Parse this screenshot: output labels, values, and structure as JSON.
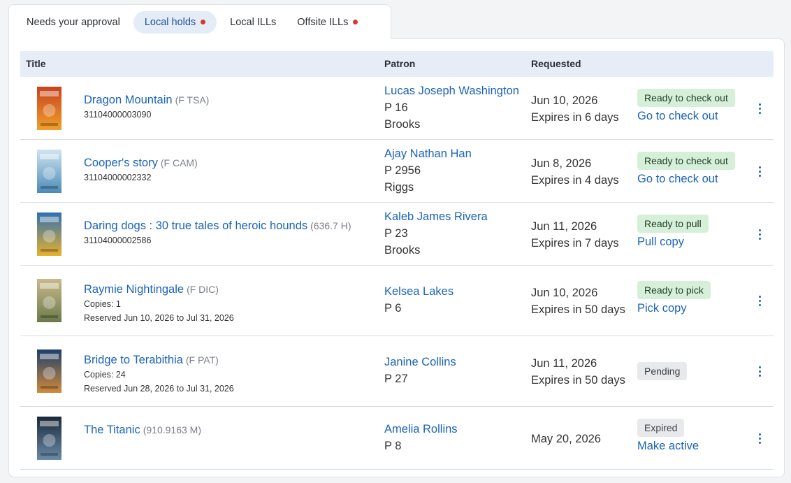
{
  "tabs": [
    {
      "label": "Needs your approval",
      "active": false,
      "dot": false
    },
    {
      "label": "Local holds",
      "active": true,
      "dot": true
    },
    {
      "label": "Local ILLs",
      "active": false,
      "dot": false
    },
    {
      "label": "Offsite ILLs",
      "active": false,
      "dot": true
    }
  ],
  "table": {
    "headers": {
      "title": "Title",
      "patron": "Patron",
      "requested": "Requested"
    },
    "rows": [
      {
        "title": "Dragon Mountain",
        "call": "(F TSA)",
        "sub1": "31104000003090",
        "sub2": "",
        "patron_name": "Lucas Joseph Washington",
        "patron_id": "P 16",
        "patron_loc": "Brooks",
        "date": "Jun 10, 2026",
        "expires": "Expires in 6 days",
        "status": "Ready to check out",
        "status_color": "green",
        "action": "Go to check out",
        "cover_colors": [
          "#c8421f",
          "#f0a02a"
        ]
      },
      {
        "title": "Cooper's story",
        "call": "(F CAM)",
        "sub1": "31104000002332",
        "sub2": "",
        "patron_name": "Ajay Nathan Han",
        "patron_id": "P 2956",
        "patron_loc": "Riggs",
        "date": "Jun 8, 2026",
        "expires": "Expires in 4 days",
        "status": "Ready to check out",
        "status_color": "green",
        "action": "Go to check out",
        "cover_colors": [
          "#cfe3f0",
          "#4a8bb8"
        ]
      },
      {
        "title": "Daring dogs : 30 true tales of heroic hounds",
        "call": "(636.7 H)",
        "sub1": "31104000002586",
        "sub2": "",
        "patron_name": "Kaleb James Rivera",
        "patron_id": "P 23",
        "patron_loc": "Brooks",
        "date": "Jun 11, 2026",
        "expires": "Expires in 7 days",
        "status": "Ready to pull",
        "status_color": "green",
        "action": "Pull copy",
        "cover_colors": [
          "#2f6fb5",
          "#e8b02a"
        ]
      },
      {
        "title": "Raymie Nightingale",
        "call": "(F DIC)",
        "sub1": "Copies: 1",
        "sub2": "Reserved Jun 10, 2026 to Jul 31, 2026",
        "patron_name": "Kelsea Lakes",
        "patron_id": "P 6",
        "patron_loc": "",
        "date": "Jun 10, 2026",
        "expires": "Expires in 50 days",
        "status": "Ready to pick",
        "status_color": "green",
        "action": "Pick copy",
        "cover_colors": [
          "#c9b98a",
          "#6b7a4a"
        ]
      },
      {
        "title": "Bridge to Terabithia",
        "call": "(F PAT)",
        "sub1": "Copies: 24",
        "sub2": "Reserved Jun 28, 2026 to Jul 31, 2026",
        "patron_name": "Janine Collins",
        "patron_id": "P 27",
        "patron_loc": "",
        "date": "Jun 11, 2026",
        "expires": "Expires in 50 days",
        "status": "Pending",
        "status_color": "grey",
        "action": "",
        "cover_colors": [
          "#1d3f6e",
          "#d08a3a"
        ]
      },
      {
        "title": "The Titanic",
        "call": "(910.9163 M)",
        "sub1": "",
        "sub2": "",
        "patron_name": "Amelia Rollins",
        "patron_id": "P 8",
        "patron_loc": "",
        "date": "May 20, 2026",
        "expires": "",
        "status": "Expired",
        "status_color": "grey",
        "action": "Make active",
        "cover_colors": [
          "#1a2a3a",
          "#6a8aa8"
        ]
      }
    ]
  },
  "colors": {
    "link": "#1b63b8",
    "accent_dot": "#d23b2c",
    "header_bg": "#e7edf7"
  }
}
